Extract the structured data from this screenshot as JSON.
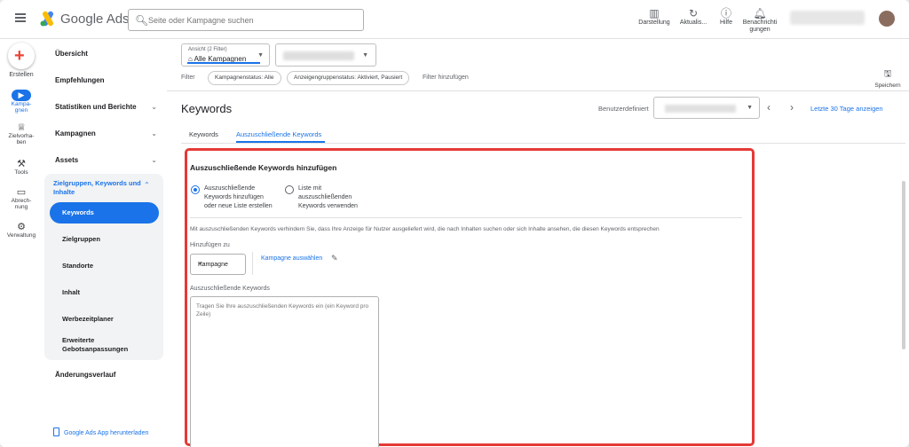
{
  "app": {
    "brand": "Google Ads",
    "search_placeholder": "Seite oder Kampagne suchen"
  },
  "toolbar": {
    "darstellung": "Darstellung",
    "aktualisieren": "Aktualis...",
    "hilfe": "Hilfe",
    "benachrichtigungen_1": "Benachrichti",
    "benachrichtigungen_2": "gungen"
  },
  "rail": {
    "create": "Erstellen",
    "campaigns_1": "Kampa-",
    "campaigns_2": "gnen",
    "goals_1": "Zielvorha-",
    "goals_2": "ben",
    "tools": "Tools",
    "billing_1": "Abrech-",
    "billing_2": "nung",
    "admin": "Verwaltung"
  },
  "nav": {
    "overview": "Übersicht",
    "recommendations": "Empfehlungen",
    "stats_reports": "Statistiken und Berichte",
    "campaigns": "Kampagnen",
    "assets": "Assets",
    "audiences_group": "Zielgruppen, Keywords und Inhalte",
    "sub_items": [
      "Keywords",
      "Zielgruppen",
      "Standorte",
      "Inhalt",
      "Werbezeitplaner",
      "Erweiterte Gebotsanpassungen"
    ],
    "change_history": "Änderungsverlauf",
    "download_app": "Google Ads App herunterladen"
  },
  "filters": {
    "view_label": "Ansicht (2 Filter)",
    "view_value": "Alle Kampagnen",
    "filter_label": "Filter",
    "chips": [
      "Kampagnenstatus: Alle",
      "Anzeigengruppenstatus: Aktiviert, Pausiert"
    ],
    "add_filter": "Filter hinzufügen",
    "save": "Speichern"
  },
  "page": {
    "title": "Keywords",
    "date_label": "Benutzerdefiniert",
    "date_range": "Letzte 30 Tage anzeigen",
    "tabs": [
      "Keywords",
      "Auszuschließende Keywords"
    ],
    "active_tab": 1
  },
  "form": {
    "title": "Auszuschließende Keywords hinzufügen",
    "radio_add_1": "Auszuschließende",
    "radio_add_2": "Keywords hinzufügen",
    "radio_add_3": "oder neue Liste erstellen",
    "radio_list_1": "Liste mit",
    "radio_list_2": "auszuschließenden",
    "radio_list_3": "Keywords verwenden",
    "description": "Mit auszuschließenden Keywords verhindern Sie, dass Ihre Anzeige für Nutzer ausgeliefert wird, die nach Inhalten suchen oder sich Inhalte ansehen, die diesen Keywords entsprechen",
    "add_to_label": "Hinzufügen zu",
    "add_to_value": "Kampagne",
    "select_campaign": "Kampagne auswählen",
    "keywords_label": "Auszuschließende Keywords",
    "keywords_placeholder": "Tragen Sie Ihre auszuschließenden Keywords ein (ein Keyword pro Zeile)"
  },
  "colors": {
    "accent": "#1a73e8",
    "highlight": "#e53935"
  },
  "icons": {
    "menu": "hamburger-icon",
    "search": "search-icon",
    "appearance": "appearance-icon",
    "refresh": "refresh-icon",
    "help": "help-icon",
    "notifications": "bell-icon",
    "create": "plus-icon",
    "campaigns": "megaphone-icon",
    "goals": "trophy-icon",
    "tools": "tools-icon",
    "billing": "credit-card-icon",
    "admin": "gear-icon",
    "save": "save-icon",
    "edit": "pencil-icon"
  }
}
